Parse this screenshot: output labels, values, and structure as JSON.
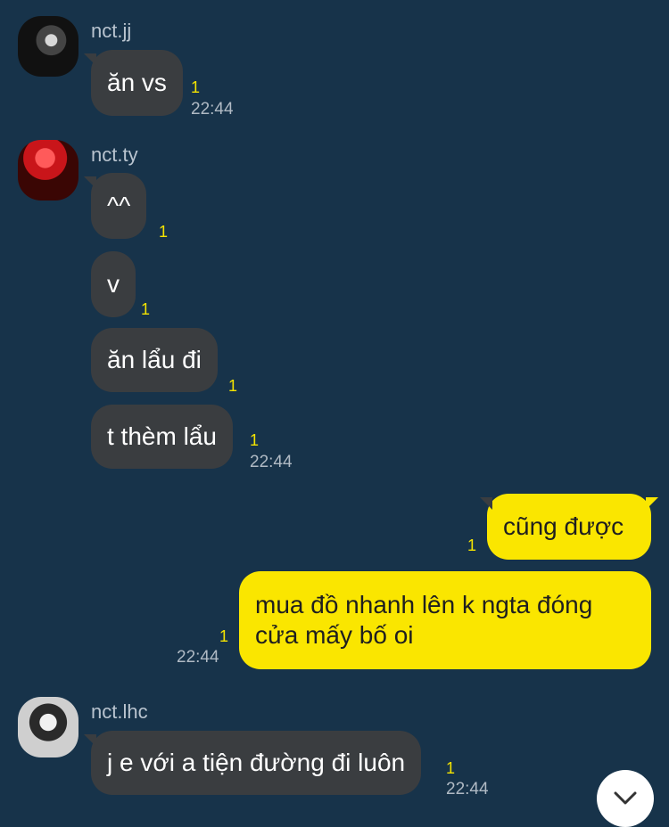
{
  "messages": [
    {
      "sender": "nct.jj",
      "text": "ăn vs",
      "unread": "1",
      "time": "22:44"
    },
    {
      "sender": "nct.ty",
      "text": "^^",
      "unread": "1"
    },
    {
      "sender": "nct.ty",
      "text": "v",
      "unread": "1"
    },
    {
      "sender": "nct.ty",
      "text": "ăn lẩu đi",
      "unread": "1"
    },
    {
      "sender": "nct.ty",
      "text": "t thèm lẩu",
      "unread": "1",
      "time": "22:44"
    },
    {
      "sender": "me",
      "text": "cũng được",
      "unread": "1"
    },
    {
      "sender": "me",
      "text": "mua đồ nhanh lên k ngta đóng cửa mấy bố oi",
      "unread": "1",
      "time": "22:44"
    },
    {
      "sender": "nct.lhc",
      "text": "j e với a tiện đường đi luôn",
      "unread": "1",
      "time": "22:44"
    }
  ],
  "icons": {
    "scroll_down": "chevron-down-icon"
  },
  "colors": {
    "background": "#17334a",
    "incoming_bubble": "#3a3d40",
    "outgoing_bubble": "#fae600",
    "unread": "#f5e400"
  }
}
